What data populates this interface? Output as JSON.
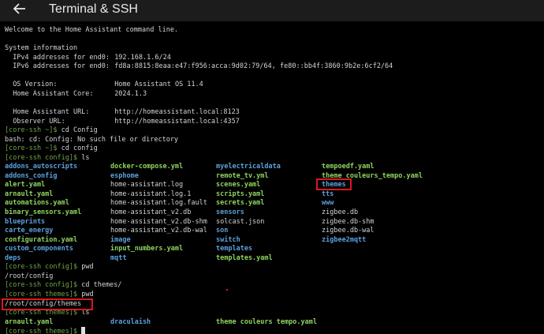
{
  "header": {
    "title": "Terminal & SSH",
    "back_icon": "arrow-left-icon"
  },
  "terminal": {
    "welcome": "Welcome to the Home Assistant command line.",
    "system_info_heading": "System information",
    "ipv4_label": "IPv4 addresses for end0:",
    "ipv4_value": "192.168.1.6/24",
    "ipv6_label": "IPv6 addresses for end0:",
    "ipv6_value": "fd8a:8815:8eaa:e47:f956:acca:9d02:79/64, fe80::bb4f:3860:9b2e:6cf2/64",
    "os_label": "OS Version:",
    "os_value": "Home Assistant OS 11.4",
    "core_label": "Home Assistant Core:",
    "core_value": "2024.1.3",
    "url_label": "Home Assistant URL:",
    "url_value": "http://homeassistant.local:8123",
    "observer_label": "Observer URL:",
    "observer_value": "http://homeassistant.local:4357",
    "prompt_home": "[core-ssh ~]$",
    "prompt_config": "[core-ssh config]$",
    "prompt_themes": "[core-ssh themes]$",
    "cmd_cd_Config": "cd Config",
    "error_line": "bash: cd: Config: No such file or directory",
    "cmd_cd_config": "cd config",
    "cmd_ls": "ls",
    "cmd_pwd": "pwd",
    "pwd_config": "/root/config",
    "cmd_cd_themes": "cd themes/",
    "pwd_themes": "/root/config/themes",
    "ls_rows": [
      [
        "addons_autoscripts",
        "docker-compose.yml",
        "myelectricaldata",
        "tempoedf.yaml"
      ],
      [
        "addons_config",
        "esphome",
        "remote_tv.yml",
        "theme_couleurs_tempo.yaml"
      ],
      [
        "alert.yaml",
        "home-assistant.log",
        "scenes.yaml",
        "themes"
      ],
      [
        "arnault.yaml",
        "home-assistant.log.1",
        "scripts.yaml",
        "tts"
      ],
      [
        "automations.yaml",
        "home-assistant.log.fault",
        "secrets.yaml",
        "www"
      ],
      [
        "binary_sensors.yaml",
        "home-assistant_v2.db",
        "sensors",
        "zigbee.db"
      ],
      [
        "blueprints",
        "home-assistant_v2.db-shm",
        "solcast.json",
        "zigbee.db-shm"
      ],
      [
        "carte_energy",
        "home-assistant_v2.db-wal",
        "son",
        "zigbee.db-wal"
      ],
      [
        "configuration.yaml",
        "image",
        "switch",
        "zigbee2mqtt"
      ],
      [
        "custom_components",
        "input_numbers.yaml",
        "templates",
        ""
      ],
      [
        "deps",
        "mqtt",
        "templates.yaml",
        ""
      ]
    ],
    "ls_themes": [
      "arnault.yaml",
      "draculaish",
      "theme couleurs tempo.yaml"
    ],
    "colors": {
      "prompt": "#6fa54a",
      "directory": "#5ca0dd",
      "yaml_file": "#8fd45f",
      "highlight": "#d9181f"
    }
  }
}
